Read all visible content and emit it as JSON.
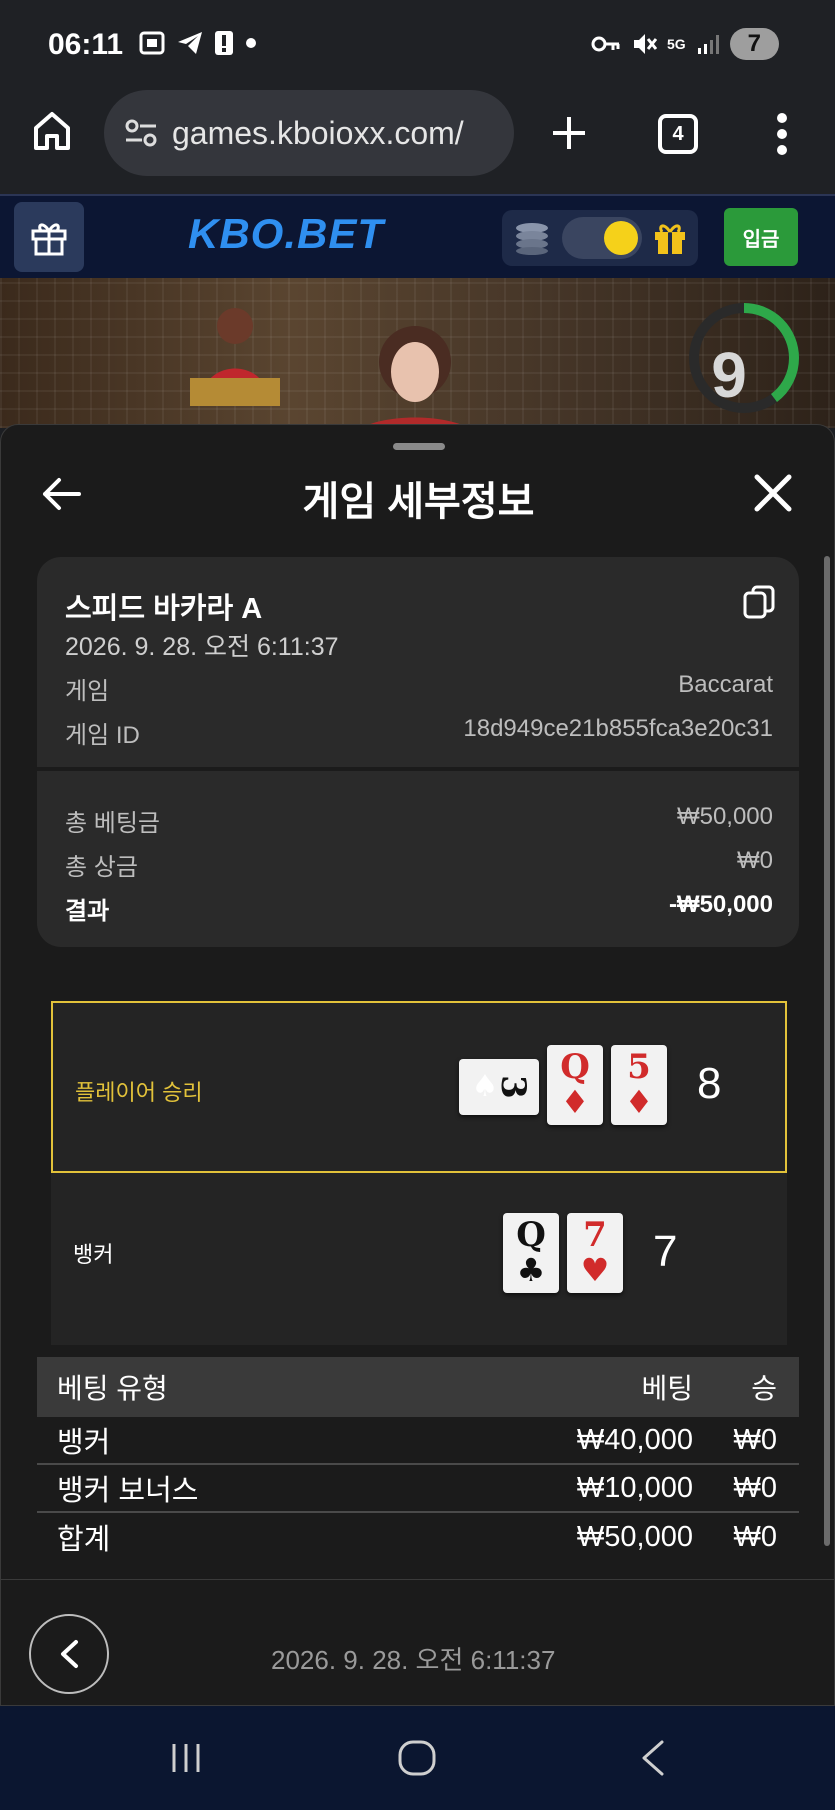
{
  "status_bar": {
    "time": "06:11",
    "battery": "7",
    "network": "5G"
  },
  "browser": {
    "url": "games.kboioxx.com/",
    "tab_count": "4"
  },
  "site": {
    "logo": "KBO.BET",
    "login_label": "입금",
    "timer_value": "9"
  },
  "sheet": {
    "title": "게임 세부정보",
    "game_name": "스피드 바카라 A",
    "game_datetime": "2026. 9. 28. 오전 6:11:37",
    "rows": [
      {
        "label": "게임",
        "value": "Baccarat"
      },
      {
        "label": "게임 ID",
        "value": "18d949ce21b855fca3e20c31"
      }
    ],
    "totals": [
      {
        "label": "총 베팅금",
        "value": "₩50,000"
      },
      {
        "label": "총 상금",
        "value": "₩0"
      }
    ],
    "result": {
      "label": "결과",
      "value": "-₩50,000"
    },
    "player": {
      "label": "플레이어 승리",
      "score": "8",
      "cards": [
        {
          "rank": "3",
          "suit": "♠",
          "color": "#111111",
          "rotated": true
        },
        {
          "rank": "Q",
          "suit": "♦",
          "color": "#d12b2b",
          "rotated": false
        },
        {
          "rank": "5",
          "suit": "♦",
          "color": "#d12b2b",
          "rotated": false
        }
      ]
    },
    "banker": {
      "label": "뱅커",
      "score": "7",
      "cards": [
        {
          "rank": "Q",
          "suit": "♣",
          "color": "#111111",
          "rotated": false
        },
        {
          "rank": "7",
          "suit": "♥",
          "color": "#d12b2b",
          "rotated": false
        }
      ]
    },
    "bet_table": {
      "headers": {
        "type": "베팅 유형",
        "bet": "베팅",
        "win": "승"
      },
      "rows": [
        {
          "type": "뱅커",
          "bet": "₩40,000",
          "win": "₩0"
        },
        {
          "type": "뱅커 보너스",
          "bet": "₩10,000",
          "win": "₩0"
        },
        {
          "type": "합계",
          "bet": "₩50,000",
          "win": "₩0"
        }
      ]
    },
    "footer_datetime": "2026. 9. 28. 오전 6:11:37"
  },
  "colors": {
    "accent_gold": "#e2c23a",
    "logo_blue": "#2f8ff0",
    "login_green": "#2b9a3a",
    "red_suit": "#d12b2b"
  },
  "icons": [
    "home-icon",
    "site-settings-icon",
    "new-tab-icon",
    "tabs-icon",
    "more-menu-icon",
    "gift-icon",
    "coins-icon",
    "back-arrow-icon",
    "close-icon",
    "copy-icon",
    "chevron-left-icon",
    "recents-nav-icon",
    "home-nav-icon",
    "back-nav-icon"
  ]
}
